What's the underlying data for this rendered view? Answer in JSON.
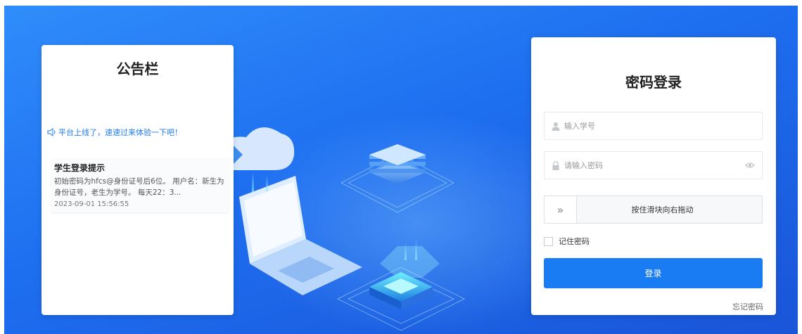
{
  "notice": {
    "title": "公告栏",
    "marquee": "平台上线了，速速过来体验一下吧！",
    "items": [
      {
        "title": "学生登录提示",
        "body": "初始密码为hfcs@身份证号后6位。 用户名：新生为身份证号，老生为学号。 每天22：3...",
        "date": "2023-09-01 15:56:55"
      }
    ]
  },
  "login": {
    "title": "密码登录",
    "username_placeholder": "输入学号",
    "password_placeholder": "请输入密码",
    "slider_icon": "»",
    "slider_text": "按住滑块向右拖动",
    "remember_label": "记住密码",
    "submit_label": "登录",
    "forgot_label": "忘记密码"
  },
  "colors": {
    "background": "#1e6ef0",
    "primary_button": "#1a7cf3",
    "marquee_text": "#1e7cf0"
  },
  "icons": [
    "speaker-icon",
    "user-icon",
    "lock-icon",
    "eye-icon",
    "slider-chevron-icon"
  ]
}
